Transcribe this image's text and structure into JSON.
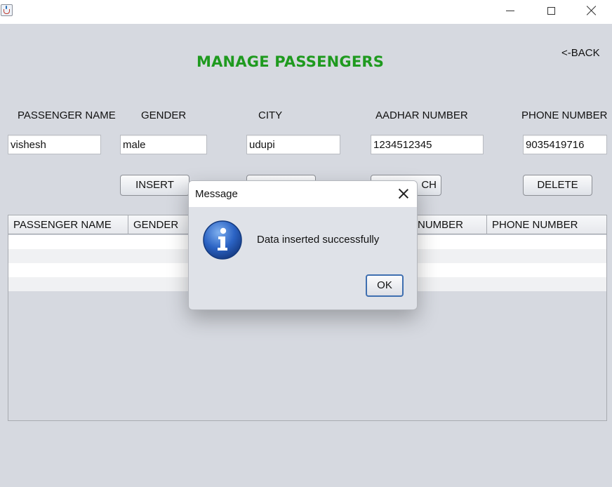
{
  "window": {
    "minimize_icon": "minimize-icon",
    "maximize_icon": "maximize-icon",
    "close_icon": "close-icon"
  },
  "header": {
    "title": "MANAGE PASSENGERS",
    "back_label": "<-BACK",
    "title_color": "#1f9a1f"
  },
  "form": {
    "labels": {
      "name": "PASSENGER NAME",
      "gender": "GENDER",
      "city": "CITY",
      "aadhar": "AADHAR NUMBER",
      "phone": "PHONE NUMBER"
    },
    "values": {
      "name": "vishesh",
      "gender": "male",
      "city": "udupi",
      "aadhar": "1234512345",
      "phone": "9035419716"
    }
  },
  "buttons": {
    "insert": "INSERT",
    "search_partial": "CH",
    "delete": "DELETE"
  },
  "table": {
    "headers": {
      "name": "PASSENGER NAME",
      "gender": "GENDER",
      "aadhar_partial": "NUMBER",
      "phone": "PHONE NUMBER"
    }
  },
  "dialog": {
    "title": "Message",
    "message": "Data inserted successfully",
    "ok_label": "OK",
    "icon": "info-icon",
    "accent": "#3f6fb0"
  }
}
